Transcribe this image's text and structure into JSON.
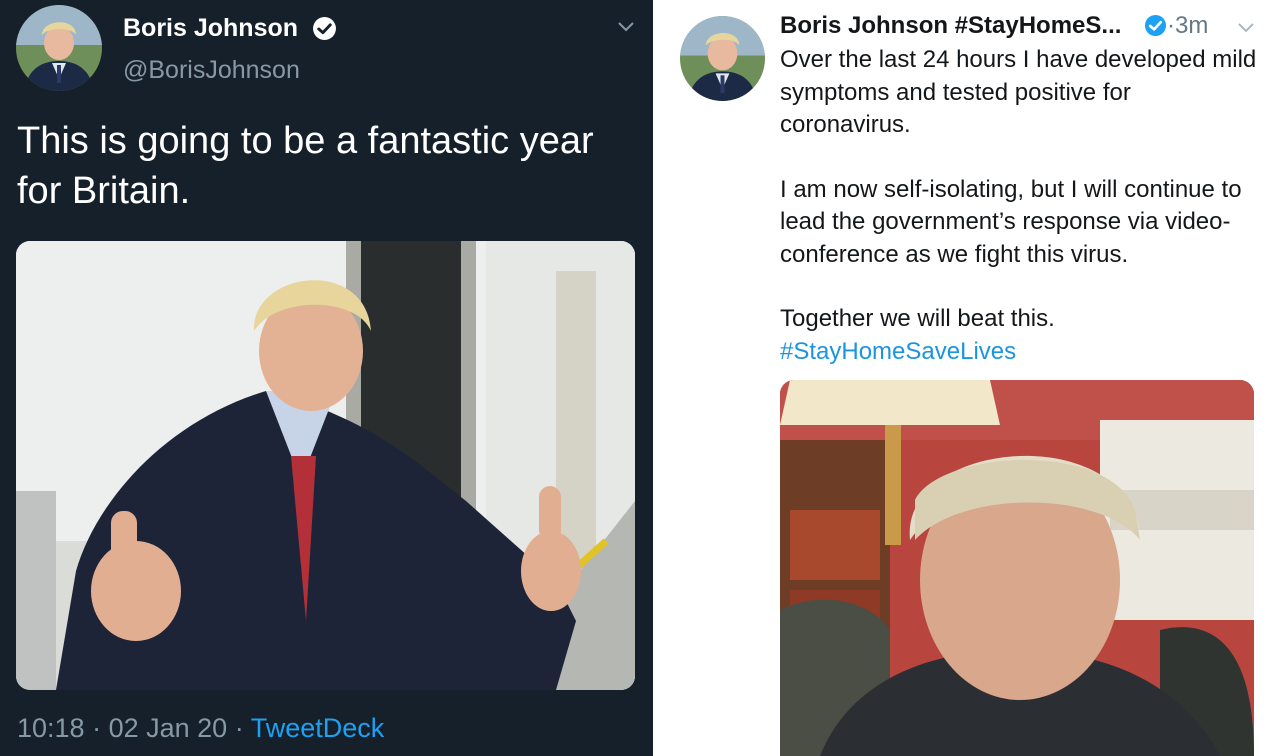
{
  "left_tweet": {
    "display_name": "Boris Johnson",
    "handle": "@BorisJohnson",
    "verified": true,
    "text": "This is going to be a fantastic year for Britain.",
    "time": "10:18",
    "separator": " · ",
    "date": "02 Jan 20",
    "client": "TweetDeck",
    "photo_alt": "Man in dark suit and red tie giving two thumbs up in a hallway",
    "colors": {
      "background": "#15202b",
      "secondary_text": "#8899a6",
      "link": "#1da1f2"
    }
  },
  "right_tweet": {
    "display_name": "Boris Johnson #StayHomeS...",
    "verified": true,
    "time": "·3m",
    "paragraphs": [
      "Over the last 24 hours I have developed mild symptoms and tested positive for coronavirus.",
      "I am now self-isolating, but I will continue to lead the government’s response via video-conference as we fight this virus.",
      "Together we will beat this."
    ],
    "hashtag": "#StayHomeSaveLives",
    "photo_alt": "Man speaking to camera in a room with a lamp, bookshelf and fireplace",
    "colors": {
      "background": "#ffffff",
      "secondary_text": "#657786",
      "link": "#1b95e0"
    }
  },
  "icons": [
    "verified-badge-icon",
    "chevron-down-icon",
    "avatar"
  ]
}
